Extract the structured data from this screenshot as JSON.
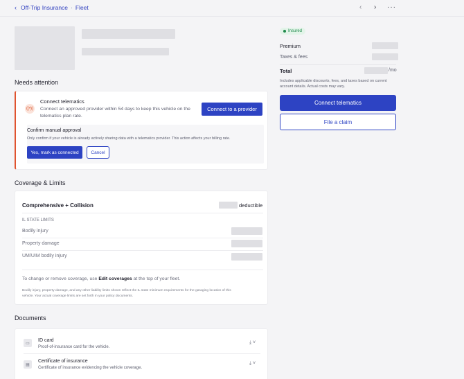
{
  "breadcrumb": {
    "parent": "Off-Trip Insurance",
    "separator": "·",
    "current": "Fleet"
  },
  "nav": {
    "prev_icon": "chevron-left-icon",
    "next_icon": "chevron-right-icon",
    "more_icon": "more-icon"
  },
  "needs_attention": {
    "title": "Needs attention",
    "telematics_title": "Connect telematics",
    "telematics_desc_1": "Connect an approved provider within 54 days to keep this vehicle on the",
    "telematics_desc_2": "telematics plan rate.",
    "connect_button": "Connect to a provider",
    "manual_title": "Confirm manual approval",
    "manual_desc": "Only confirm if your vehicle is already actively sharing data with a telematics provider. This action affects your billing rate.",
    "confirm_button": "Yes, mark as connected",
    "cancel_button": "Cancel"
  },
  "coverage": {
    "title": "Coverage & Limits",
    "plan": "Comprehensive + Collision",
    "deductible_label": "deductible",
    "state_limits_label": "IL STATE LIMITS",
    "rows": [
      "Bodily injury",
      "Property damage",
      "UM/UIM bodily injury"
    ],
    "change_text_pre": "To change or remove coverage, use ",
    "change_link": "Edit coverages",
    "change_text_post": " at the top of your fleet.",
    "fine_print_1": "Bodily injury, property damage, and any other liability limits shown reflect the IL state minimum requirements for the garaging location of this",
    "fine_print_2": "vehicle. Your actual coverage limits are set forth in your policy documents."
  },
  "documents": {
    "title": "Documents",
    "items": [
      {
        "name": "ID card",
        "desc": "Proof-of-insurance card for the vehicle."
      },
      {
        "name": "Certificate of insurance",
        "desc": "Certificate of insurance evidencing the vehicle coverage."
      }
    ]
  },
  "summary": {
    "badge": "Insured",
    "premium_label": "Premium",
    "taxes_label": "Taxes & fees",
    "total_label": "Total",
    "per_month": "/mo",
    "note_1": "Includes applicable discounts, fees, and taxes based on current",
    "note_2": "account details. Actual costs may vary.",
    "connect_button": "Connect telematics",
    "claim_button": "File a claim"
  },
  "colors": {
    "accent": "#2d43c3",
    "warning": "#e0532f",
    "insured_green": "#1f8a4c"
  }
}
